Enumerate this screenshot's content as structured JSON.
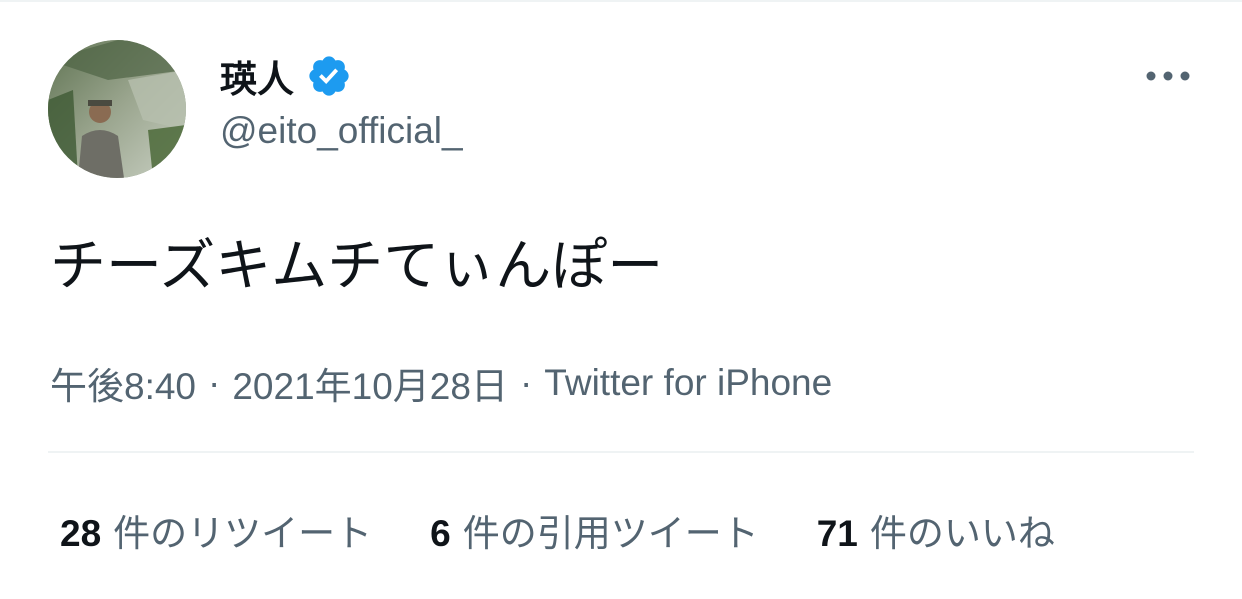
{
  "author": {
    "display_name": "瑛人",
    "handle": "@eito_official_",
    "verified": true,
    "verified_badge_color": "#1d9bf0"
  },
  "tweet": {
    "text": "チーズキムチてぃんぽー"
  },
  "meta": {
    "time": "午後8:40",
    "separator_1": "·",
    "date": "2021年10月28日",
    "separator_2": "·",
    "source": "Twitter for iPhone"
  },
  "stats": {
    "retweets": {
      "count": "28",
      "label": "件のリツイート"
    },
    "quotes": {
      "count": "6",
      "label": "件の引用ツイート"
    },
    "likes": {
      "count": "71",
      "label": "件のいいね"
    }
  },
  "icons": {
    "more": "more-horizontal-icon",
    "verified": "verified-badge-icon"
  },
  "colors": {
    "text_primary": "#0f1419",
    "text_secondary": "#536471",
    "divider": "#eff3f4"
  }
}
